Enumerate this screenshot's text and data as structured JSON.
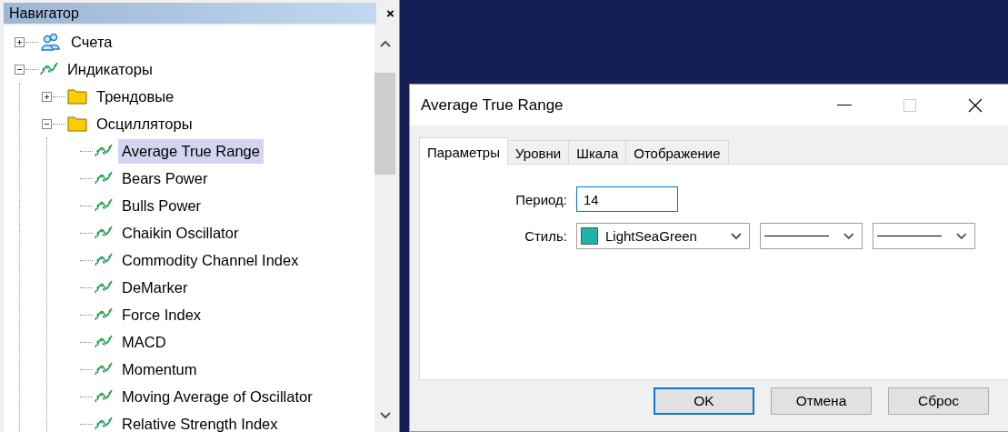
{
  "navigator": {
    "title": "Навигатор",
    "tree": [
      {
        "label": "Счета",
        "kind": "accounts",
        "expanded": false,
        "selected": false
      },
      {
        "label": "Индикаторы",
        "kind": "indicator",
        "expanded": true,
        "selected": false,
        "children": [
          {
            "label": "Трендовые",
            "kind": "folder",
            "expanded": false,
            "selected": false
          },
          {
            "label": "Осцилляторы",
            "kind": "folder",
            "expanded": true,
            "selected": false,
            "children": [
              {
                "label": "Average True Range",
                "kind": "indicator",
                "selected": true
              },
              {
                "label": "Bears Power",
                "kind": "indicator",
                "selected": false
              },
              {
                "label": "Bulls Power",
                "kind": "indicator",
                "selected": false
              },
              {
                "label": "Chaikin Oscillator",
                "kind": "indicator",
                "selected": false
              },
              {
                "label": "Commodity Channel Index",
                "kind": "indicator",
                "selected": false
              },
              {
                "label": "DeMarker",
                "kind": "indicator",
                "selected": false
              },
              {
                "label": "Force Index",
                "kind": "indicator",
                "selected": false
              },
              {
                "label": "MACD",
                "kind": "indicator",
                "selected": false
              },
              {
                "label": "Momentum",
                "kind": "indicator",
                "selected": false
              },
              {
                "label": "Moving Average of Oscillator",
                "kind": "indicator",
                "selected": false
              },
              {
                "label": "Relative Strength Index",
                "kind": "indicator",
                "selected": false
              }
            ]
          }
        ]
      }
    ]
  },
  "dialog": {
    "title": "Average True Range",
    "tabs": [
      {
        "label": "Параметры",
        "selected": true
      },
      {
        "label": "Уровни",
        "selected": false
      },
      {
        "label": "Шкала",
        "selected": false
      },
      {
        "label": "Отображение",
        "selected": false
      }
    ],
    "period": {
      "label": "Период:",
      "value": "14"
    },
    "style": {
      "label": "Стиль:",
      "color": "#20b2aa",
      "color_name": "LightSeaGreen",
      "line_selects": [
        {
          "kind": "solid"
        },
        {
          "kind": "solid"
        }
      ]
    },
    "buttons": [
      {
        "label": "OK",
        "default": true
      },
      {
        "label": "Отмена",
        "default": false
      },
      {
        "label": "Сброс",
        "default": false
      }
    ]
  }
}
